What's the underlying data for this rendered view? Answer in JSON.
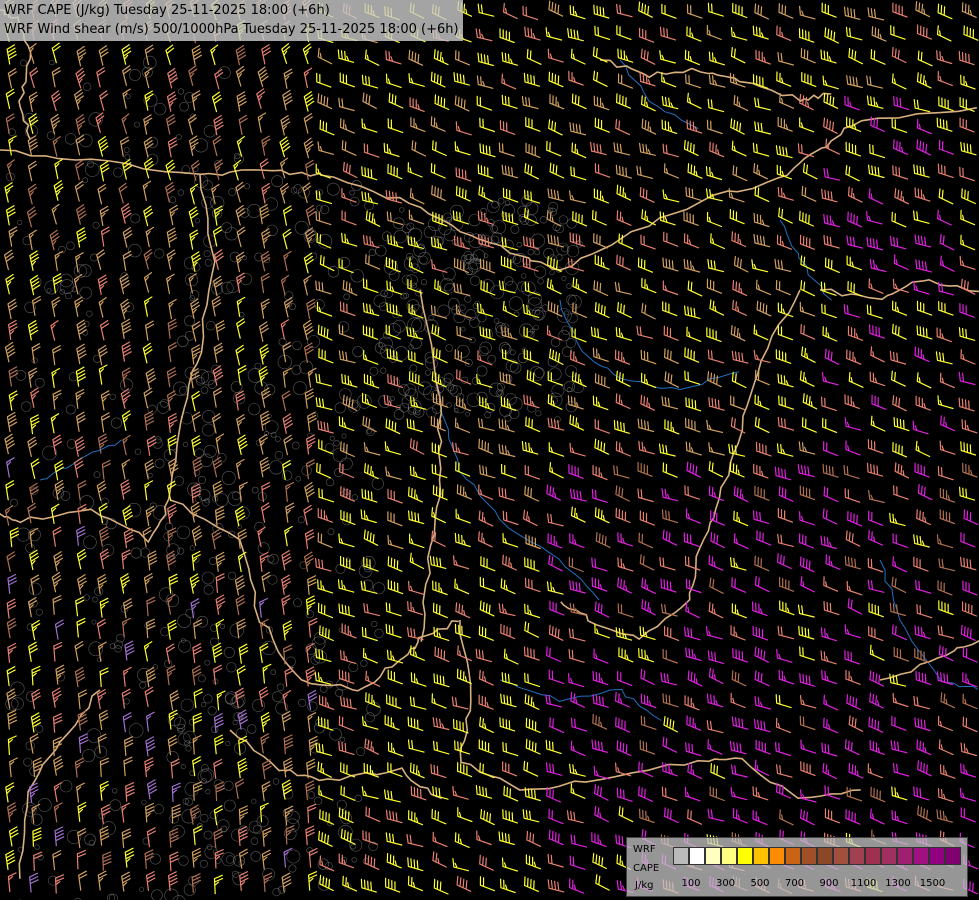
{
  "titles": {
    "line1": "WRF CAPE (J/kg) Tuesday 25-11-2025 18:00 (+6h)",
    "line2": "WRF Wind shear (m/s) 500/1000hPa Tuesday 25-11-2025 18:00 (+6h)"
  },
  "legend": {
    "label1": "WRF",
    "label2": "CAPE",
    "label3": "J/kg",
    "colors": [
      "#bbbbbb",
      "#ffffff",
      "#ffffc0",
      "#ffff80",
      "#ffff00",
      "#ffc000",
      "#ff8c00",
      "#c86414",
      "#a05028",
      "#8c4628",
      "#a0503c",
      "#a04050",
      "#a03050",
      "#a03060",
      "#a02070",
      "#a01080",
      "#900080",
      "#800070"
    ],
    "ticks": [
      "100",
      "300",
      "500",
      "700",
      "900",
      "1100",
      "1300",
      "1500"
    ]
  },
  "barb_colors": {
    "tan": "#d2a060",
    "yellow": "#ffff30",
    "salmon": "#e88070",
    "magenta": "#e020e0",
    "brown": "#b07050",
    "violet": "#a070d0"
  },
  "map_colors": {
    "border": "#d8b080",
    "river": "#2070c0",
    "contour": "#a0a0a0"
  }
}
